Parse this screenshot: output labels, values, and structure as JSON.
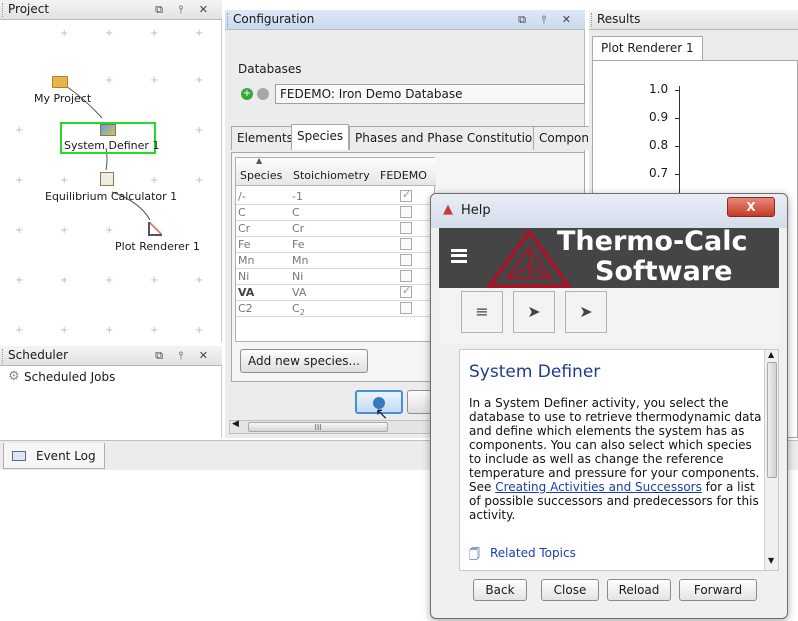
{
  "project": {
    "title": "Project",
    "nodes": {
      "my_project": "My Project",
      "system_definer": "System Definer 1",
      "equilibrium_calculator": "Equilibrium Calculator 1",
      "plot_renderer": "Plot Renderer 1"
    }
  },
  "scheduler": {
    "title": "Scheduler",
    "item": "Scheduled Jobs"
  },
  "event_log": {
    "tab": "Event Log"
  },
  "header_buttons": "⧉ ⫯ ✕",
  "configuration": {
    "title": "Configuration",
    "databases_label": "Databases",
    "database_value": "FEDEMO: Iron Demo Database",
    "tabs": [
      "Elements",
      "Species",
      "Phases and Phase Constitution",
      "Compon"
    ],
    "columns": [
      "Species",
      "Stoichiometry",
      "FEDEMO"
    ],
    "species": [
      {
        "name": "/-",
        "stoich": "-1",
        "checked": true,
        "bold": false
      },
      {
        "name": "C",
        "stoich": "C",
        "checked": false,
        "bold": false
      },
      {
        "name": "Cr",
        "stoich": "Cr",
        "checked": false,
        "bold": false
      },
      {
        "name": "Fe",
        "stoich": "Fe",
        "checked": false,
        "bold": false
      },
      {
        "name": "Mn",
        "stoich": "Mn",
        "checked": false,
        "bold": false
      },
      {
        "name": "Ni",
        "stoich": "Ni",
        "checked": false,
        "bold": false
      },
      {
        "name": "VA",
        "stoich": "VA",
        "checked": true,
        "bold": true
      },
      {
        "name": "C2",
        "stoich": "C",
        "sub": "2",
        "checked": false,
        "bold": false
      }
    ],
    "add_species_button": "Add new species...",
    "scroll_thumb": "III"
  },
  "results": {
    "title": "Results",
    "tab": "Plot Renderer 1",
    "yticks": [
      "1.0",
      "0.9",
      "0.8",
      "0.7"
    ]
  },
  "help": {
    "title": "Help",
    "logo_line1": "Thermo-Calc",
    "logo_line2": "Software",
    "heading": "System Definer",
    "body_before": "In a System Definer activity, you select the database to use to retrieve thermodynamic data and define which elements the system has as components. You can also select which species to include as well as change the reference temperature and pressure for your components. See ",
    "link": "Creating Activities and Successors",
    "body_after": " for a list of possible successors and predecessors for this activity.",
    "related": "Related Topics",
    "buttons": {
      "back": "Back",
      "close": "Close",
      "reload": "Reload",
      "forward": "Forward"
    },
    "close_x": "X"
  },
  "colors": {
    "selection_green": "#22dd22",
    "link_blue": "#1a3fa8",
    "heading_blue": "#1f3c8c",
    "help_dark": "#454545",
    "logo_red": "#a3162a"
  }
}
